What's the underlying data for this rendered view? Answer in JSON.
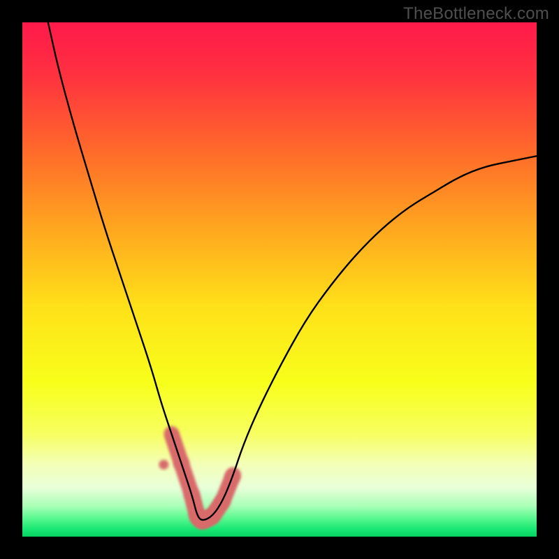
{
  "watermark": "TheBottleneck.com",
  "gradient": {
    "stops": [
      {
        "offset": 0.0,
        "color": "#ff1a4b"
      },
      {
        "offset": 0.1,
        "color": "#ff3040"
      },
      {
        "offset": 0.25,
        "color": "#ff6a2a"
      },
      {
        "offset": 0.4,
        "color": "#ffa61f"
      },
      {
        "offset": 0.55,
        "color": "#ffe019"
      },
      {
        "offset": 0.7,
        "color": "#f7ff1a"
      },
      {
        "offset": 0.8,
        "color": "#f7ff60"
      },
      {
        "offset": 0.86,
        "color": "#f3ffb8"
      },
      {
        "offset": 0.905,
        "color": "#e8ffd8"
      },
      {
        "offset": 0.94,
        "color": "#aaffb8"
      },
      {
        "offset": 0.965,
        "color": "#58f88e"
      },
      {
        "offset": 0.985,
        "color": "#19e874"
      },
      {
        "offset": 1.0,
        "color": "#06d060"
      }
    ]
  },
  "chart_data": {
    "type": "line",
    "title": "",
    "xlabel": "",
    "ylabel": "",
    "xlim": [
      0,
      100
    ],
    "ylim": [
      0,
      100
    ],
    "grid": false,
    "note": "Bottleneck curve: y is mismatch % (0 ideal at bottom, 100 worst at top). Minimum around x≈34.",
    "series": [
      {
        "name": "bottleneck-curve",
        "x": [
          5,
          7,
          10,
          13,
          16,
          19,
          22,
          25,
          27,
          29,
          31,
          33,
          34,
          35,
          37,
          39,
          41,
          43,
          46,
          50,
          55,
          60,
          65,
          70,
          75,
          80,
          85,
          90,
          95,
          100
        ],
        "values": [
          100,
          91,
          80,
          70,
          60,
          51,
          42,
          33,
          26,
          20,
          14,
          8,
          4,
          3,
          4,
          7,
          12,
          18,
          25,
          33,
          42,
          49,
          55,
          60,
          64,
          67,
          70,
          72,
          73,
          74
        ]
      }
    ],
    "highlight_band": {
      "x_start": 28,
      "x_end": 41,
      "note": "pink fuzzy marker band near minimum"
    }
  }
}
